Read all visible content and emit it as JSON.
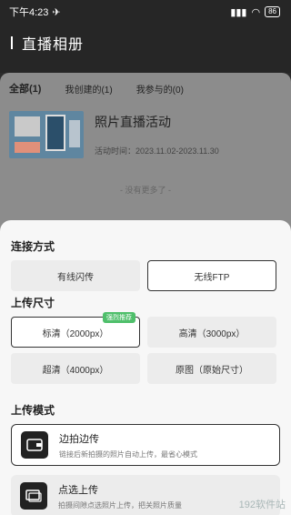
{
  "status_bar": {
    "time": "下午4:23",
    "battery": "86"
  },
  "header": {
    "title": "直播相册"
  },
  "tabs": [
    {
      "label": "全部(1)"
    },
    {
      "label": "我创建的(1)"
    },
    {
      "label": "我参与的(0)"
    }
  ],
  "album": {
    "title": "照片直播活动",
    "time": "活动时间：2023.11.02-2023.11.30"
  },
  "no_more": "- 没有更多了 -",
  "connect": {
    "title": "连接方式",
    "options": [
      {
        "label": "有线闪传"
      },
      {
        "label": "无线FTP"
      }
    ]
  },
  "upload_size": {
    "title": "上传尺寸",
    "badge": "强烈推荐",
    "options": [
      {
        "label": "标清（2000px）"
      },
      {
        "label": "高清（3000px）"
      },
      {
        "label": "超清（4000px）"
      },
      {
        "label": "原图（原始尺寸）"
      }
    ]
  },
  "upload_mode": {
    "title": "上传模式",
    "modes": [
      {
        "title": "边拍边传",
        "desc": "链接后新拍摄的照片自动上传，最省心模式"
      },
      {
        "title": "点选上传",
        "desc": "拍摄间隙点选照片上传，把关照片质量"
      }
    ]
  },
  "watermark": "192软件站",
  "colors": {
    "selected_border": "#333333",
    "badge": "#4fbf6b",
    "sheet": "#f7f7f7"
  }
}
